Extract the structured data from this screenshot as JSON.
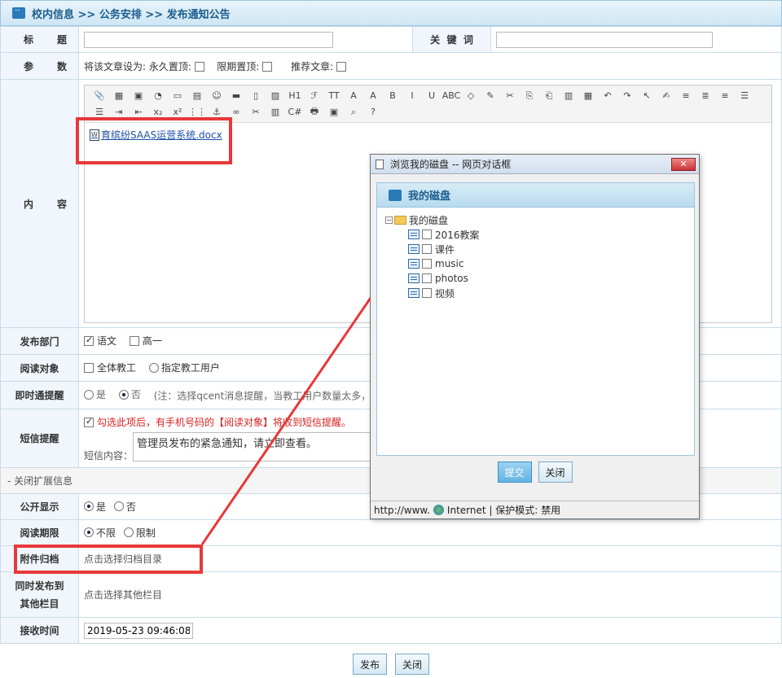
{
  "breadcrumb": "校内信息 >> 公务安排 >> 发布通知公告",
  "form": {
    "title_label": [
      "标",
      "题"
    ],
    "keyword_label": [
      "关",
      "键",
      "词"
    ],
    "params_label": [
      "参",
      "数"
    ],
    "params_text": "将该文章设为: 永久置顶:",
    "limit_top": "限期置顶:",
    "recommend": "推荐文章:",
    "content_label": [
      "内",
      "容"
    ],
    "attachment_name": "育缤纷SAAS运营系统.docx",
    "dept_label": "发布部门",
    "dept_opts": [
      {
        "label": "语文",
        "checked": true
      },
      {
        "label": "高一",
        "checked": false
      }
    ],
    "reader_label": "阅读对象",
    "reader_opts": [
      {
        "label": "全体教工"
      },
      {
        "label": "指定教工用户"
      }
    ],
    "instant_label": "即时通提醒",
    "instant_yes": "是",
    "instant_no": "否",
    "instant_note": "(注：选择qcent消息提醒，当教工用户数量太多，",
    "sms_label": "短信提醒",
    "sms_check": "勾选此项后，有手机号码的【阅读对象】将收到短信提醒。",
    "sms_content_label": "短信内容：",
    "sms_content": "管理员发布的紧急通知，请立即查看。",
    "ext_toggle": "- 关闭扩展信息",
    "public_label": "公开显示",
    "public_yes": "是",
    "public_no": "否",
    "period_label": "阅读期限",
    "period_unlimited": "不限",
    "period_limit": "限制",
    "archive_label": "附件归档",
    "archive_link": "点击选择归档目录",
    "also_publish_label_1": "同时发布到",
    "also_publish_label_2": "其他栏目",
    "also_publish_link": "点击选择其他栏目",
    "receive_label": "接收时间",
    "receive_time": "2019-05-23 09:46:08"
  },
  "buttons": {
    "publish": "发布",
    "close": "关闭"
  },
  "toolbar": {
    "items": [
      "📎",
      "▦",
      "▣",
      "◔",
      "▭",
      "▤",
      "☺",
      "▬",
      "▯",
      "▨",
      "H1",
      "ℱ",
      "TT",
      "A",
      "A",
      "B",
      "I",
      "U",
      "ABC",
      "◇",
      "✎",
      "✂",
      "⎘",
      "⎗",
      "▥",
      "▦",
      "↶",
      "↷",
      "↖",
      "✍",
      "≡",
      "≣",
      "≡",
      "☰",
      "☰",
      "⇥",
      "⇤",
      "x₂",
      "x²",
      "⋮⋮",
      "⚓",
      "∞",
      "✂",
      "▥",
      "C#",
      "🖶",
      "▣",
      "⌕",
      "?"
    ]
  },
  "dialog": {
    "title": "浏览我的磁盘 -- 网页对话框",
    "header": "我的磁盘",
    "root": "我的磁盘",
    "folders": [
      "2016教案",
      "课件",
      "music",
      "photos",
      "视频"
    ],
    "submit": "提交",
    "close": "关闭",
    "status_url": "http://www.",
    "status_zone": "Internet | 保护模式: 禁用"
  },
  "colors": {
    "accent": "#1b5c8d",
    "highlight": "#e8383a",
    "warning": "#d92020"
  }
}
